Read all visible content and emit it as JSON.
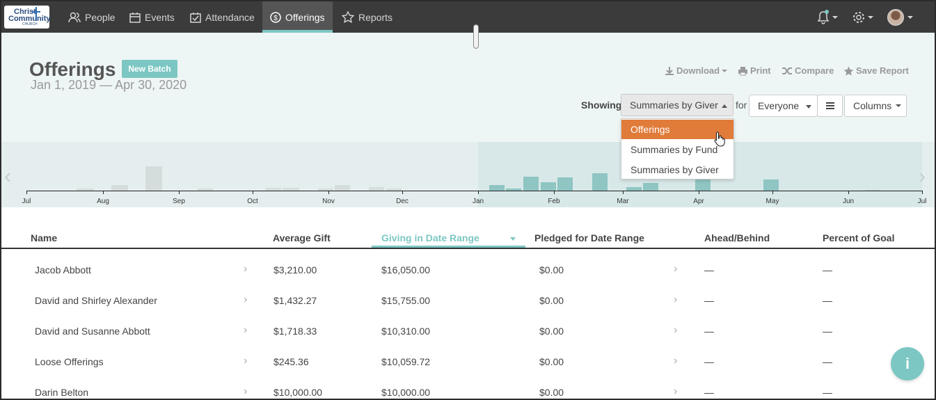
{
  "logo": {
    "line1": "Christ",
    "line2": "Community",
    "line3": "CHURCH"
  },
  "nav": {
    "people": "People",
    "events": "Events",
    "attendance": "Attendance",
    "offerings": "Offerings",
    "reports": "Reports"
  },
  "header": {
    "title": "Offerings",
    "new_batch": "New Batch",
    "date_range": "Jan 1, 2019 — Apr 30, 2020",
    "download": "Download",
    "print": "Print",
    "compare": "Compare",
    "save_report": "Save Report",
    "showing_label": "Showing",
    "showing_value": "Summaries by Giver",
    "for_label": "for",
    "everyone": "Everyone",
    "columns": "Columns"
  },
  "dropdown": {
    "options": [
      "Offerings",
      "Summaries by Fund",
      "Summaries by Giver"
    ],
    "highlighted": "Offerings"
  },
  "timeline": {
    "months": [
      "Jul",
      "Aug",
      "Sep",
      "Oct",
      "Nov",
      "Dec",
      "Jan",
      "Feb",
      "Mar",
      "Apr",
      "May",
      "Jun",
      "Jul"
    ],
    "selection_start": "Jan",
    "selection_end": "Jul"
  },
  "table": {
    "columns": [
      "Name",
      "Average Gift",
      "Giving in Date Range",
      "Pledged for Date Range",
      "Ahead/Behind",
      "Percent of Goal"
    ],
    "sorted_column": "Giving in Date Range",
    "rows": [
      {
        "name": "Jacob Abbott",
        "avg": "$3,210.00",
        "giving": "$16,050.00",
        "pledged": "$0.00",
        "ahead": "—",
        "percent": "—"
      },
      {
        "name": "David and Shirley Alexander",
        "avg": "$1,432.27",
        "giving": "$15,755.00",
        "pledged": "$0.00",
        "ahead": "—",
        "percent": "—"
      },
      {
        "name": "David and Susanne Abbott",
        "avg": "$1,718.33",
        "giving": "$10,310.00",
        "pledged": "$0.00",
        "ahead": "—",
        "percent": "—"
      },
      {
        "name": "Loose Offerings",
        "avg": "$245.36",
        "giving": "$10,059.72",
        "pledged": "$0.00",
        "ahead": "—",
        "percent": "—"
      },
      {
        "name": "Darin Belton",
        "avg": "$10,000.00",
        "giving": "$10,000.00",
        "pledged": "$0.00",
        "ahead": "—",
        "percent": "—"
      }
    ]
  },
  "colors": {
    "accent": "#7cc7c3",
    "active_option": "#e07b39",
    "nav_bg": "#3b3b3b"
  },
  "info_button": "i"
}
